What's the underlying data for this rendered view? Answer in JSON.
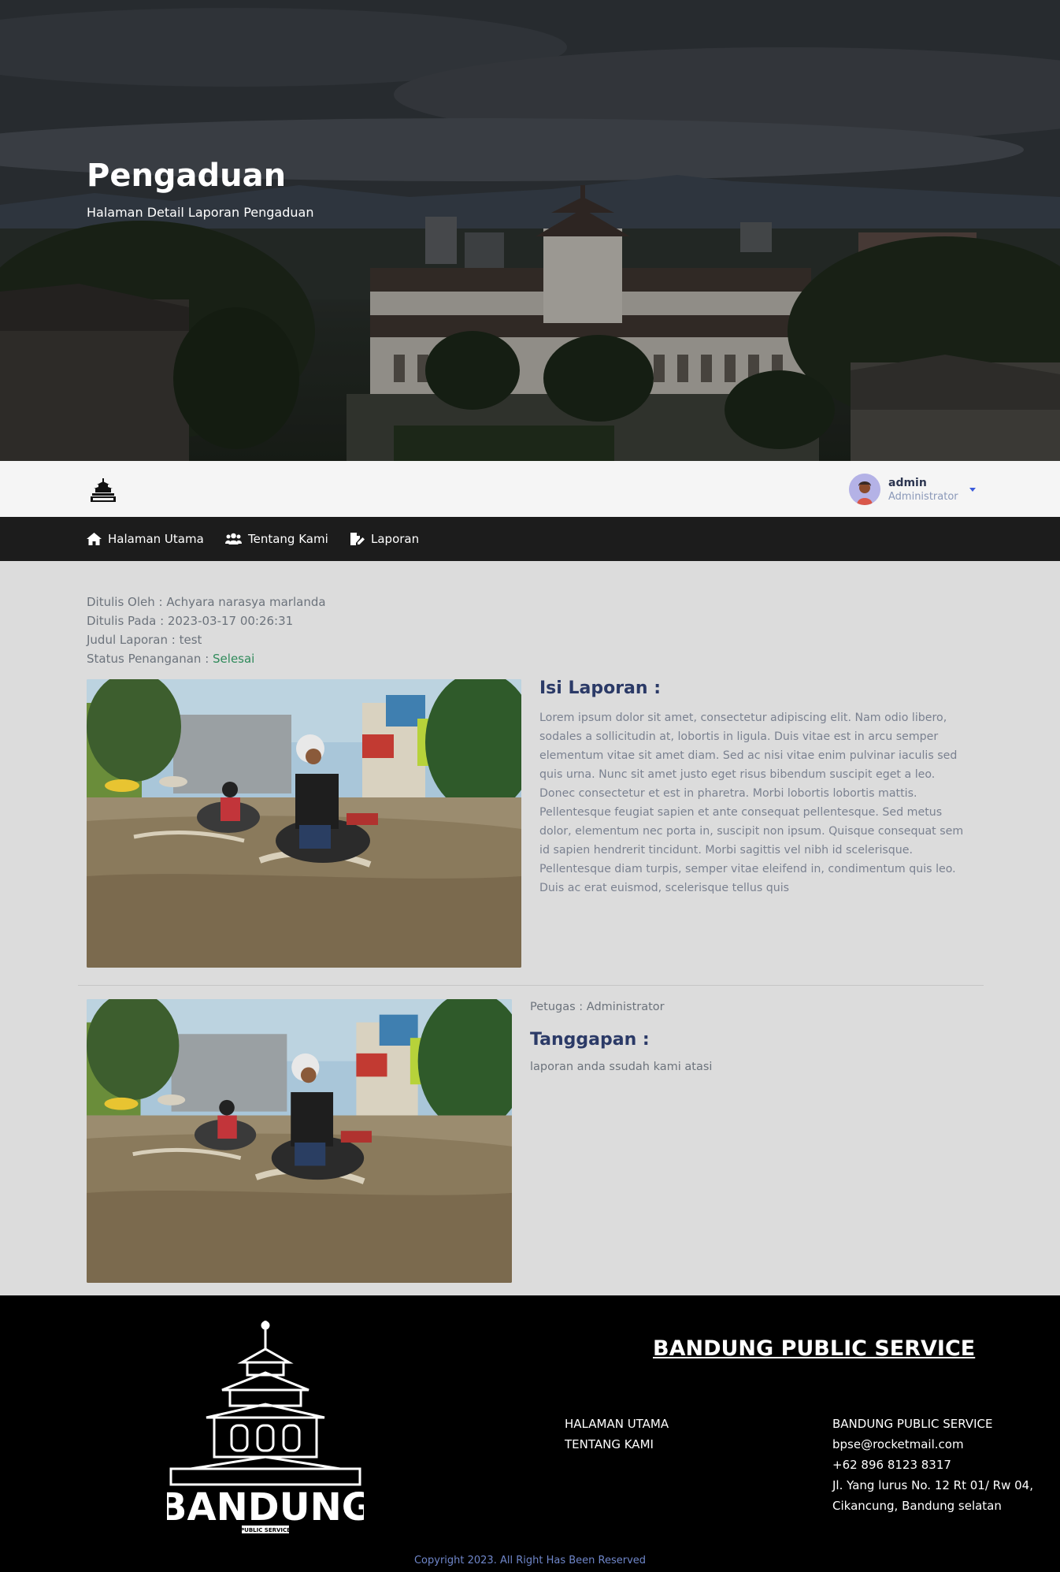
{
  "hero": {
    "title": "Pengaduan",
    "subtitle": "Halaman Detail Laporan Pengaduan"
  },
  "topbar": {
    "logo_icon": "bandung-logo-icon",
    "user": {
      "name": "admin",
      "role": "Administrator"
    }
  },
  "nav": {
    "items": [
      {
        "label": "Halaman Utama",
        "icon": "home-icon"
      },
      {
        "label": "Tentang Kami",
        "icon": "users-icon"
      },
      {
        "label": "Laporan",
        "icon": "report-edit-icon"
      }
    ]
  },
  "report": {
    "author_label": "Ditulis Oleh : ",
    "author": "Achyara narasya marlanda",
    "date_label": "Ditulis Pada : ",
    "date": "2023-03-17 00:26:31",
    "title_label": "Judul Laporan : ",
    "title": "test",
    "status_label": "Status Penanganan : ",
    "status": "Selesai",
    "status_color": "#2f8a5a",
    "content_heading": "Isi Laporan :",
    "content": "Lorem ipsum dolor sit amet, consectetur adipiscing elit. Nam odio libero, sodales a sollicitudin at, lobortis in ligula. Duis vitae est in arcu semper elementum vitae sit amet diam. Sed ac nisi vitae enim pulvinar iaculis sed quis urna. Nunc sit amet justo eget risus bibendum suscipit eget a leo. Donec consectetur et est in pharetra. Morbi lobortis lobortis mattis. Pellentesque feugiat sapien et ante consequat pellentesque. Sed metus dolor, elementum nec porta in, suscipit non ipsum. Quisque consequat sem id sapien hendrerit tincidunt. Morbi sagittis vel nibh id scelerisque. Pellentesque diam turpis, semper vitae eleifend in, condimentum quis leo. Duis ac erat euismod, scelerisque tellus quis"
  },
  "response": {
    "officer_label": "Petugas : ",
    "officer": "Administrator",
    "heading": "Tanggapan :",
    "content": "laporan anda ssudah kami atasi"
  },
  "footer": {
    "logo_text": "BANDUNG",
    "logo_subtext": "PUBLIC SERVICE",
    "brand": "BANDUNG PUBLIC SERVICE",
    "links": [
      "HALAMAN UTAMA",
      "TENTANG KAMI"
    ],
    "contact": {
      "name": "BANDUNG PUBLIC SERVICE",
      "email": "bpse@rocketmail.com",
      "phone": "+62 896 8123 8317",
      "address": "Jl. Yang lurus No. 12 Rt 01/ Rw 04, Cikancung, Bandung selatan"
    },
    "copyright": "Copyright 2023. All Right Has Been Reserved"
  }
}
